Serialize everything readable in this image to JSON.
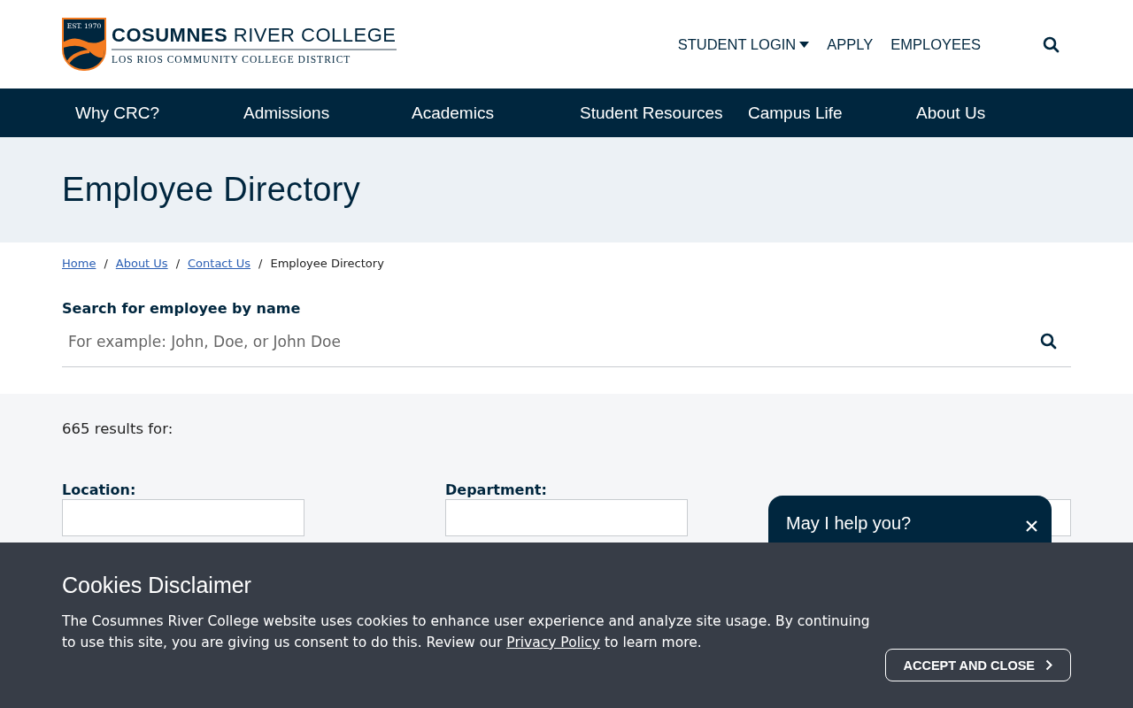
{
  "logo": {
    "badge": "EST. 1970",
    "name_bold": "COSUMNES",
    "name_rest": "RIVER COLLEGE",
    "district": "LOS RIOS COMMUNITY COLLEGE DISTRICT"
  },
  "utility_nav": [
    {
      "label": "STUDENT LOGIN",
      "dropdown": true
    },
    {
      "label": "APPLY",
      "dropdown": false
    },
    {
      "label": "EMPLOYEES",
      "dropdown": false
    }
  ],
  "main_nav": [
    "Why CRC?",
    "Admissions",
    "Academics",
    "Student Resources",
    "Campus Life",
    "About Us"
  ],
  "page_title": "Employee Directory",
  "breadcrumbs": [
    {
      "label": "Home",
      "link": true
    },
    {
      "separator": "/",
      "label": "About Us",
      "link": true
    },
    {
      "separator": "/",
      "label": "Contact Us",
      "link": true
    },
    {
      "separator": "/",
      "label": "Employee Directory",
      "link": false
    }
  ],
  "search": {
    "label": "Search for employee by name",
    "placeholder": "For example: John, Doe, or John Doe"
  },
  "results": "665 results for:",
  "filters": [
    {
      "kind": "dropdown",
      "label": "Location:"
    },
    {
      "kind": "dropdown",
      "label": "Department:"
    },
    {
      "kind": "dropdown"
    }
  ],
  "chat": {
    "title": "May I help you?"
  },
  "cookies": {
    "title": "Cookies Disclaimer",
    "text_before": "The Cosumnes River College website uses cookies to enhance user experience and analyze site usage. By continuing to use this site, you are giving us consent to do this. Review our ",
    "link": "Privacy Policy",
    "text_after": " to learn more.",
    "button": "ACCEPT AND CLOSE"
  }
}
